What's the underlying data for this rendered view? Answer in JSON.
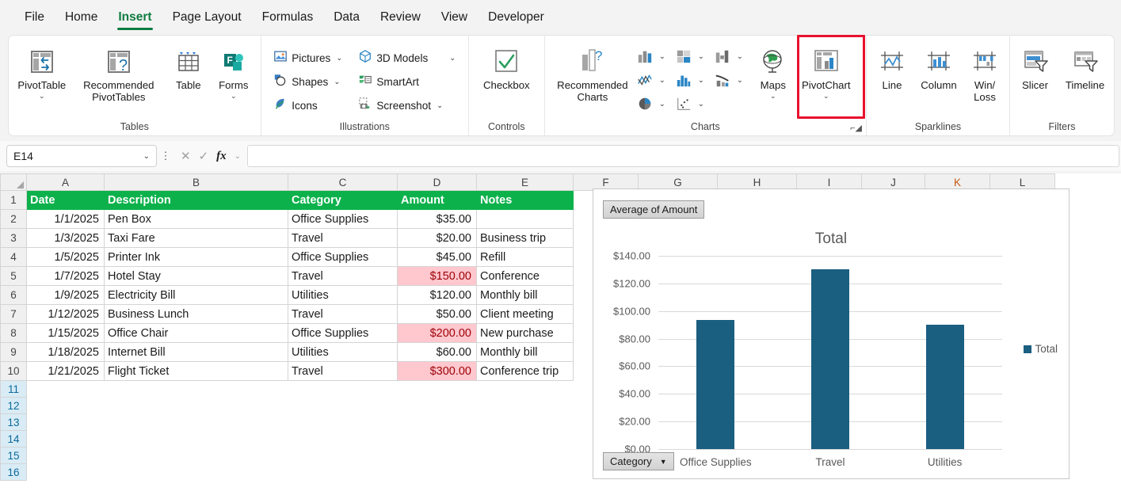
{
  "tabs": [
    {
      "label": "File",
      "active": false
    },
    {
      "label": "Home",
      "active": false
    },
    {
      "label": "Insert",
      "active": true
    },
    {
      "label": "Page Layout",
      "active": false
    },
    {
      "label": "Formulas",
      "active": false
    },
    {
      "label": "Data",
      "active": false
    },
    {
      "label": "Review",
      "active": false
    },
    {
      "label": "View",
      "active": false
    },
    {
      "label": "Developer",
      "active": false
    }
  ],
  "ribbon": {
    "groups": {
      "tables": {
        "label": "Tables",
        "pivottable": "PivotTable",
        "recommended_pivottables": "Recommended PivotTables",
        "table": "Table",
        "forms": "Forms"
      },
      "illustrations": {
        "label": "Illustrations",
        "pictures": "Pictures",
        "shapes": "Shapes",
        "icons": "Icons",
        "models3d": "3D Models",
        "smartart": "SmartArt",
        "screenshot": "Screenshot"
      },
      "controls": {
        "label": "Controls",
        "checkbox": "Checkbox"
      },
      "charts": {
        "label": "Charts",
        "recommended_charts": "Recommended Charts",
        "maps": "Maps",
        "pivotchart": "PivotChart",
        "highlighted": "pivotchart",
        "highlight_color": "#e8112d"
      },
      "sparklines": {
        "label": "Sparklines",
        "line": "Line",
        "column": "Column",
        "winloss": "Win/ Loss"
      },
      "filters": {
        "label": "Filters",
        "slicer": "Slicer",
        "timeline": "Timeline"
      }
    }
  },
  "formula_bar": {
    "name_box": "E14",
    "formula": "",
    "cancel_icon": "cancel-icon",
    "enter_icon": "enter-icon",
    "fx_label": "fx"
  },
  "sheet": {
    "columns": [
      "A",
      "B",
      "C",
      "D",
      "E",
      "F",
      "G",
      "H",
      "I",
      "J",
      "K",
      "L"
    ],
    "selected_column": "K",
    "rows": [
      "1",
      "2",
      "3",
      "4",
      "5",
      "6",
      "7",
      "8",
      "9",
      "10",
      "11",
      "12",
      "13",
      "14",
      "15",
      "16"
    ],
    "selected_rows": [
      "11",
      "12",
      "13",
      "14",
      "15",
      "16"
    ],
    "headers": [
      "Date",
      "Description",
      "Category",
      "Amount",
      "Notes"
    ],
    "header_bg": "#0cb14b",
    "highlight_bg": "#ffc7ce",
    "highlight_fg": "#9c0006",
    "data": [
      {
        "date": "1/1/2025",
        "description": "Pen Box",
        "category": "Office Supplies",
        "amount": "$35.00",
        "notes": "",
        "highlight": false
      },
      {
        "date": "1/3/2025",
        "description": "Taxi Fare",
        "category": "Travel",
        "amount": "$20.00",
        "notes": "Business trip",
        "highlight": false
      },
      {
        "date": "1/5/2025",
        "description": "Printer Ink",
        "category": "Office Supplies",
        "amount": "$45.00",
        "notes": "Refill",
        "highlight": false
      },
      {
        "date": "1/7/2025",
        "description": "Hotel Stay",
        "category": "Travel",
        "amount": "$150.00",
        "notes": "Conference",
        "highlight": true
      },
      {
        "date": "1/9/2025",
        "description": "Electricity Bill",
        "category": "Utilities",
        "amount": "$120.00",
        "notes": "Monthly bill",
        "highlight": false
      },
      {
        "date": "1/12/2025",
        "description": "Business Lunch",
        "category": "Travel",
        "amount": "$50.00",
        "notes": "Client meeting",
        "highlight": false
      },
      {
        "date": "1/15/2025",
        "description": "Office Chair",
        "category": "Office Supplies",
        "amount": "$200.00",
        "notes": "New purchase",
        "highlight": true
      },
      {
        "date": "1/18/2025",
        "description": "Internet Bill",
        "category": "Utilities",
        "amount": "$60.00",
        "notes": "Monthly bill",
        "highlight": false
      },
      {
        "date": "1/21/2025",
        "description": "Flight Ticket",
        "category": "Travel",
        "amount": "$300.00",
        "notes": "Conference trip",
        "highlight": true
      }
    ]
  },
  "pivotchart": {
    "value_field_button": "Average of Amount",
    "axis_field_button": "Category",
    "axis_field_arrow": "filter-dropdown-arrow"
  },
  "chart_data": {
    "type": "bar",
    "title": "Total",
    "categories": [
      "Office Supplies",
      "Travel",
      "Utilities"
    ],
    "series": [
      {
        "name": "Total",
        "values": [
          93.33,
          130.0,
          90.0
        ]
      }
    ],
    "yticks": [
      "$0.00",
      "$20.00",
      "$40.00",
      "$60.00",
      "$80.00",
      "$100.00",
      "$120.00",
      "$140.00"
    ],
    "ytick_values": [
      0,
      20,
      40,
      60,
      80,
      100,
      120,
      140
    ],
    "ylim": [
      0,
      140
    ],
    "xlabel": "",
    "ylabel": "",
    "grid": true,
    "legend_position": "right",
    "legend": [
      "Total"
    ],
    "bar_color": "#1a5e80"
  }
}
